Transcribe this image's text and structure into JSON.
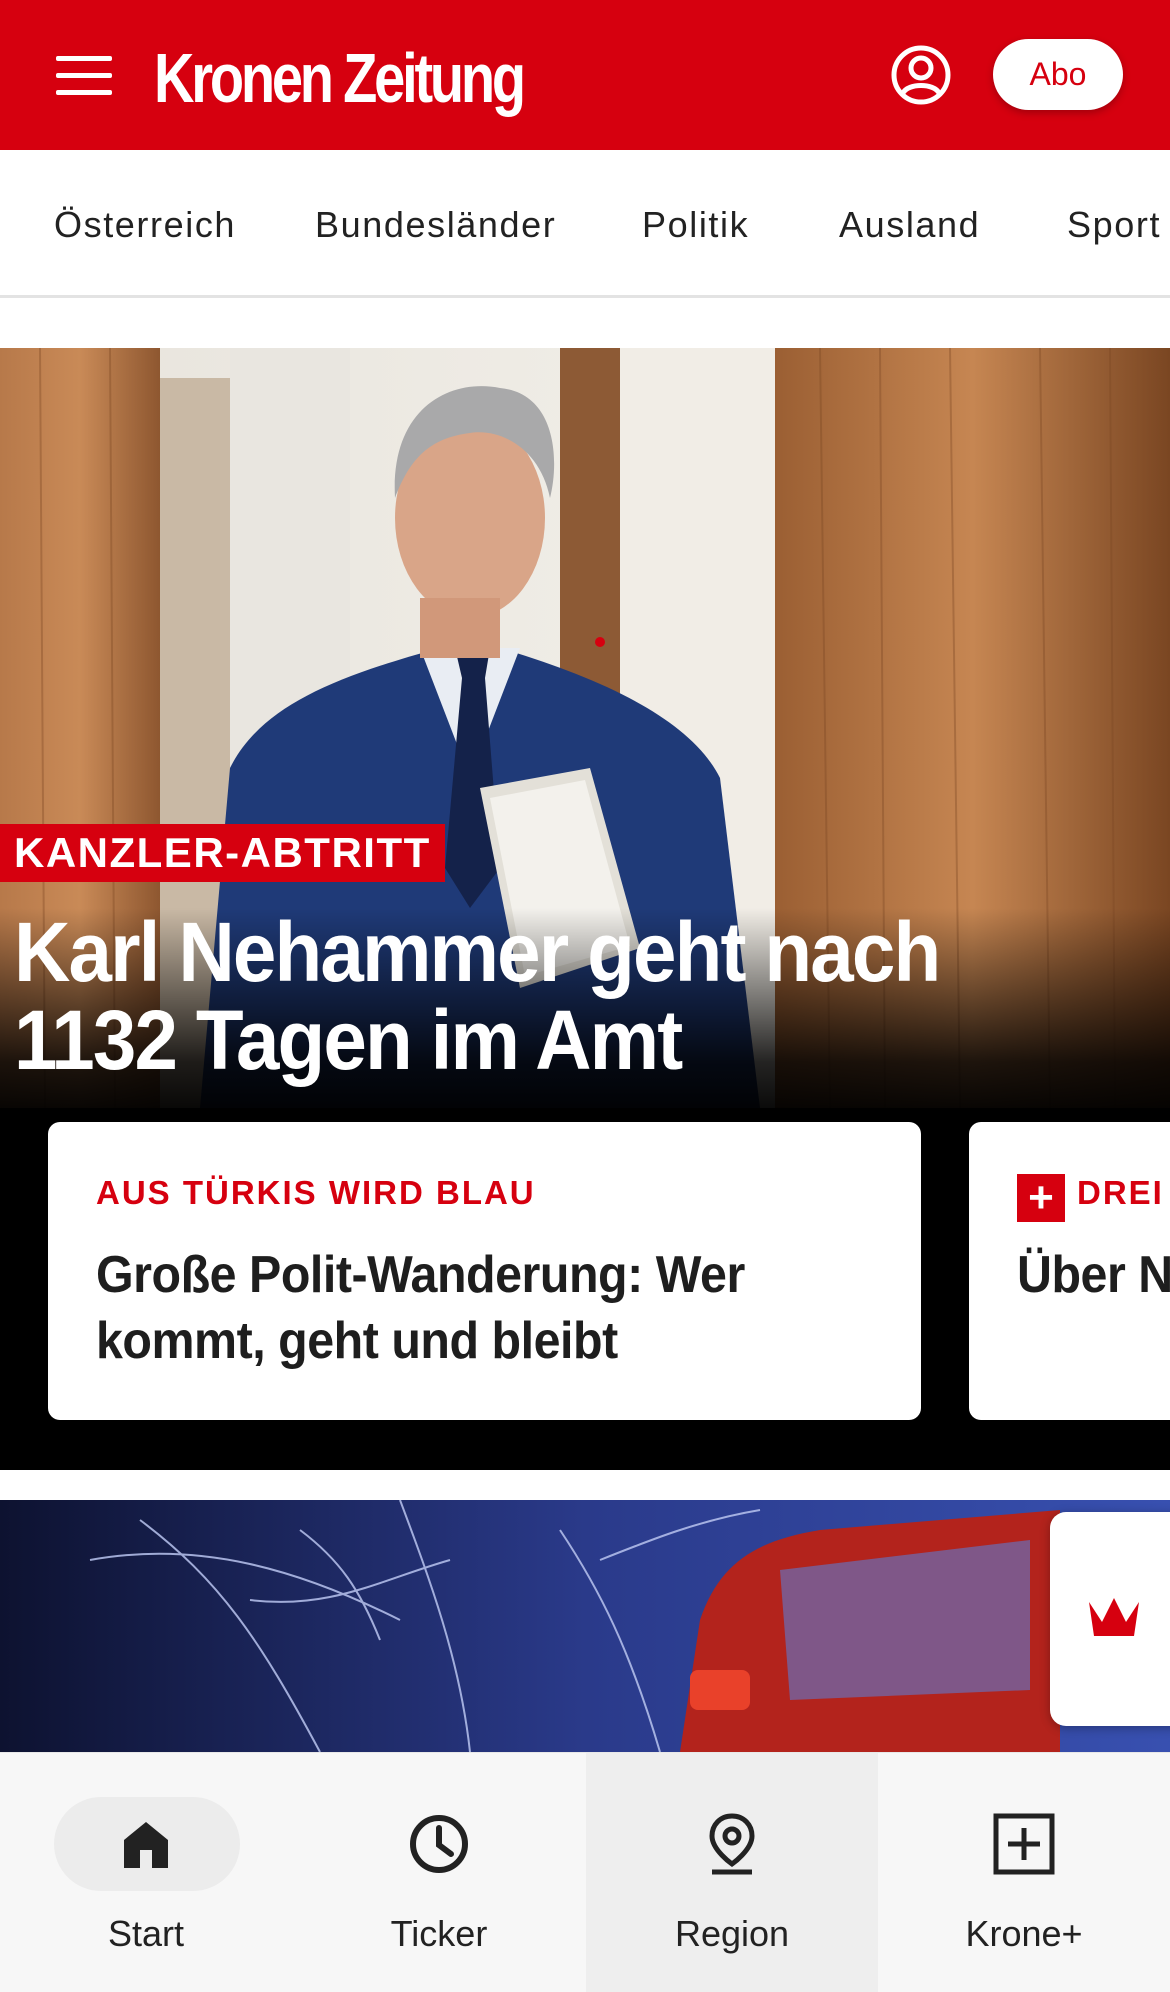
{
  "header": {
    "logo": "Kronen Zeitung",
    "menu_icon": "hamburger-menu-icon",
    "user_icon": "user-account-icon",
    "abo_label": "Abo",
    "brand_color": "#d6000f"
  },
  "nav": {
    "items": [
      {
        "label": "Österreich"
      },
      {
        "label": "Bundesländer"
      },
      {
        "label": "Politik"
      },
      {
        "label": "Ausland"
      },
      {
        "label": "Sport"
      }
    ]
  },
  "hero": {
    "kicker": "KANZLER-ABTRITT",
    "title": "Karl Nehammer geht nach 1132 Tagen im Amt",
    "cards": [
      {
        "kicker": "AUS TÜRKIS WIRD BLAU",
        "title": "Große Polit-Wanderung: Wer kommt, geht und bleibt"
      },
      {
        "kicker": "DREI",
        "title": "Über N schnel",
        "badge_icon": "krone-plus-icon"
      }
    ]
  },
  "story2": {
    "image": "night-scene-fire-truck-trees",
    "widget_icon": "krone-crown-icon"
  },
  "tabbar": {
    "tabs": [
      {
        "label": "Start",
        "icon": "home-icon",
        "active": true
      },
      {
        "label": "Ticker",
        "icon": "clock-icon",
        "active": false
      },
      {
        "label": "Region",
        "icon": "location-pin-icon",
        "active": false
      },
      {
        "label": "Krone+",
        "icon": "plus-square-icon",
        "active": false
      }
    ]
  }
}
